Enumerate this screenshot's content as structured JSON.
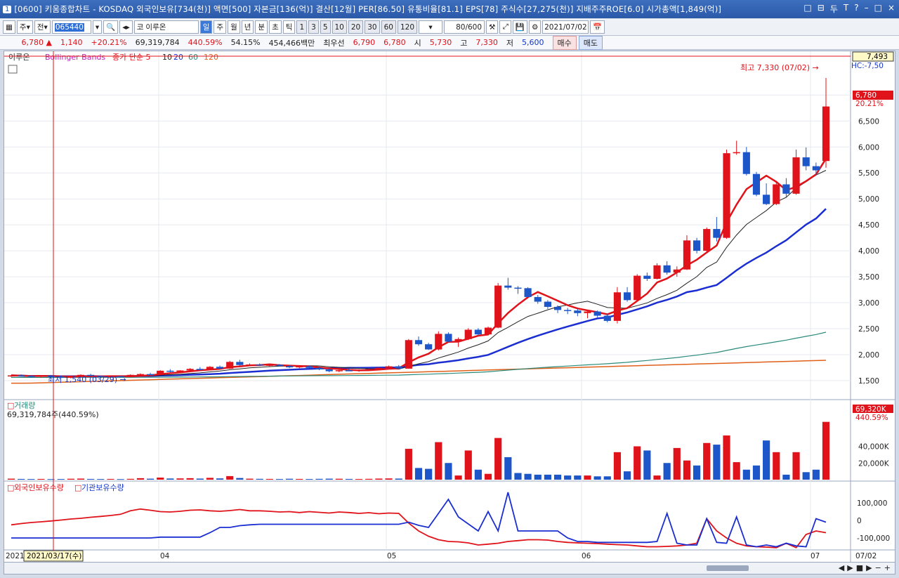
{
  "title": {
    "window_num": "1",
    "text": "[0600] 키움종합차트 - KOSDAQ 외국인보유[734(천)] 액면[500] 자본금[136(억)] 결산[12월] PER[86.50] 유통비율[81.1] EPS[78] 주식수[27,275(천)] 지배주주ROE[6.0] 시가총액[1,849(억)]",
    "controls": [
      "□",
      "⊟",
      "두",
      "T",
      "?",
      "–",
      "□",
      "×"
    ]
  },
  "toolbar": {
    "type_select": "주",
    "market_select": "전",
    "stock_code": "065440",
    "stock_name": "이루온",
    "periods": [
      "일",
      "주",
      "월",
      "년",
      "분",
      "초",
      "틱"
    ],
    "period_selected": "일",
    "intervals": [
      "1",
      "3",
      "5",
      "10",
      "20",
      "30",
      "60",
      "120"
    ],
    "count": "80/600",
    "date": "2021/07/02"
  },
  "pricebar": {
    "price": "6,780 ▲",
    "change": "1,140",
    "change_pct": "+20.21%",
    "volume": "69,319,784",
    "volume_pct": "440.59%",
    "turnover_pct": "54.15%",
    "amount": "454,466백만",
    "priority_label": "최우선",
    "ask": "6,790",
    "bid": "6,780",
    "open_label": "시",
    "open": "5,730",
    "high_label": "고",
    "high": "7,330",
    "low_label": "저",
    "low": "5,600",
    "buy_label": "매수",
    "sell_label": "매도"
  },
  "chart_labels": {
    "stock": "이루온",
    "bollinger": "Bollinger Bands",
    "ma_title": "종가 단순 5",
    "ma_periods": [
      "10",
      "20",
      "60",
      "120"
    ],
    "high_note": "최고 7,330 (07/02) →",
    "low_note": "최저 1,540 (03/29) →",
    "hc_label": "HC:-7,50",
    "price_tag": "6,780",
    "price_pct_tag": "20.21%",
    "top_price_tag": "7,493",
    "volume_title": "거래량",
    "volume_value": "69,319,784주(440.59%)",
    "volume_tag": "69,320K",
    "volume_pct_tag": "440.59%",
    "holdings_foreign": "외국인보유수량",
    "holdings_inst": "기관보유수량",
    "date_box": "2021/03/17(수)",
    "month_start": "2021/",
    "month_labels": [
      "04",
      "05",
      "06",
      "07"
    ],
    "end_date": "07/02"
  },
  "chart_data": {
    "type": "candlestick",
    "price_ticks": [
      7000,
      6500,
      6000,
      5500,
      5000,
      4500,
      4000,
      3500,
      3000,
      2500,
      2000,
      1500
    ],
    "price_range": [
      1350,
      7600
    ],
    "volume_ticks": [
      "40,000K",
      "20,000K"
    ],
    "volume_range": [
      0,
      80000
    ],
    "holdings_ticks": [
      "100,000",
      "0",
      "-100,000"
    ],
    "holdings_range": [
      -160000,
      160000
    ],
    "colors": {
      "up": "#e0121a",
      "down": "#1c56c8",
      "ma5": "#e0121a",
      "ma10": "#222222",
      "ma20": "#1a2ed1",
      "ma60": "#2a8a7a",
      "ma120": "#e0601a"
    },
    "candles": [
      [
        1580,
        1610,
        1570,
        1600,
        1200
      ],
      [
        1600,
        1620,
        1580,
        1590,
        900
      ],
      [
        1590,
        1600,
        1560,
        1575,
        800
      ],
      [
        1575,
        1600,
        1560,
        1595,
        900
      ],
      [
        1595,
        1610,
        1570,
        1580,
        700
      ],
      [
        1580,
        1600,
        1550,
        1560,
        800
      ],
      [
        1560,
        1580,
        1540,
        1575,
        1100
      ],
      [
        1575,
        1620,
        1570,
        1610,
        1300
      ],
      [
        1610,
        1630,
        1580,
        1590,
        900
      ],
      [
        1590,
        1600,
        1560,
        1570,
        800
      ],
      [
        1570,
        1590,
        1550,
        1585,
        900
      ],
      [
        1585,
        1600,
        1560,
        1570,
        700
      ],
      [
        1570,
        1620,
        1565,
        1610,
        1000
      ],
      [
        1610,
        1640,
        1600,
        1625,
        1800
      ],
      [
        1625,
        1650,
        1610,
        1615,
        1200
      ],
      [
        1615,
        1700,
        1610,
        1690,
        2500
      ],
      [
        1690,
        1720,
        1660,
        1670,
        1400
      ],
      [
        1670,
        1700,
        1650,
        1695,
        1500
      ],
      [
        1695,
        1740,
        1690,
        1725,
        1800
      ],
      [
        1725,
        1760,
        1700,
        1710,
        1300
      ],
      [
        1710,
        1780,
        1700,
        1765,
        2200
      ],
      [
        1765,
        1790,
        1720,
        1730,
        1500
      ],
      [
        1730,
        1880,
        1725,
        1860,
        4300
      ],
      [
        1860,
        1900,
        1790,
        1800,
        2000
      ],
      [
        1800,
        1830,
        1780,
        1810,
        1200
      ],
      [
        1810,
        1830,
        1780,
        1790,
        1000
      ],
      [
        1790,
        1820,
        1760,
        1805,
        900
      ],
      [
        1805,
        1820,
        1770,
        1780,
        800
      ],
      [
        1780,
        1800,
        1740,
        1755,
        1100
      ],
      [
        1755,
        1790,
        1740,
        1775,
        900
      ],
      [
        1775,
        1790,
        1740,
        1745,
        800
      ],
      [
        1745,
        1760,
        1700,
        1715,
        1000
      ],
      [
        1715,
        1730,
        1660,
        1680,
        1200
      ],
      [
        1680,
        1720,
        1660,
        1700,
        1100
      ],
      [
        1700,
        1730,
        1680,
        1690,
        900
      ],
      [
        1690,
        1720,
        1670,
        1710,
        800
      ],
      [
        1710,
        1740,
        1690,
        1720,
        1000
      ],
      [
        1720,
        1760,
        1700,
        1745,
        1300
      ],
      [
        1745,
        1790,
        1730,
        1775,
        1500
      ],
      [
        1775,
        1800,
        1720,
        1730,
        1300
      ],
      [
        1730,
        2300,
        1730,
        2280,
        37000
      ],
      [
        2280,
        2350,
        2170,
        2200,
        14000
      ],
      [
        2200,
        2230,
        2090,
        2100,
        13000
      ],
      [
        2100,
        2450,
        2080,
        2400,
        45000
      ],
      [
        2400,
        2430,
        2240,
        2250,
        20000
      ],
      [
        2250,
        2330,
        2150,
        2300,
        5000
      ],
      [
        2300,
        2510,
        2280,
        2480,
        35000
      ],
      [
        2480,
        2510,
        2370,
        2390,
        12000
      ],
      [
        2390,
        2540,
        2380,
        2520,
        7000
      ],
      [
        2520,
        3380,
        2510,
        3330,
        50000
      ],
      [
        3330,
        3480,
        3250,
        3290,
        27000
      ],
      [
        3290,
        3320,
        3170,
        3280,
        8000
      ],
      [
        3280,
        3300,
        3080,
        3110,
        7000
      ],
      [
        3110,
        3150,
        2980,
        3020,
        6000
      ],
      [
        3020,
        3050,
        2880,
        2920,
        6000
      ],
      [
        2920,
        2950,
        2800,
        2860,
        6000
      ],
      [
        2860,
        2900,
        2780,
        2850,
        5000
      ],
      [
        2850,
        2880,
        2740,
        2800,
        5000
      ],
      [
        2800,
        2860,
        2700,
        2830,
        5000
      ],
      [
        2830,
        2850,
        2720,
        2750,
        4000
      ],
      [
        2750,
        2780,
        2620,
        2650,
        4000
      ],
      [
        2650,
        3300,
        2600,
        3200,
        33000
      ],
      [
        3200,
        3300,
        3020,
        3050,
        10000
      ],
      [
        3050,
        3550,
        3040,
        3520,
        40000
      ],
      [
        3520,
        3580,
        3420,
        3460,
        35000
      ],
      [
        3460,
        3760,
        3450,
        3720,
        5000
      ],
      [
        3720,
        3800,
        3540,
        3580,
        20000
      ],
      [
        3580,
        3700,
        3500,
        3640,
        38000
      ],
      [
        3640,
        4300,
        3630,
        4200,
        23000
      ],
      [
        4200,
        4250,
        3950,
        4000,
        17000
      ],
      [
        4000,
        4450,
        3980,
        4420,
        44000
      ],
      [
        4420,
        4650,
        4180,
        4250,
        42000
      ],
      [
        4250,
        5950,
        4230,
        5880,
        53000
      ],
      [
        5880,
        6120,
        5850,
        5900,
        21000
      ],
      [
        5900,
        6000,
        5450,
        5480,
        12000
      ],
      [
        5480,
        5520,
        5050,
        5080,
        17000
      ],
      [
        5080,
        5300,
        4880,
        4900,
        47000
      ],
      [
        4900,
        5350,
        4880,
        5280,
        33000
      ],
      [
        5280,
        5400,
        5020,
        5100,
        6000
      ],
      [
        5100,
        5950,
        5080,
        5800,
        33000
      ],
      [
        5800,
        5990,
        5550,
        5630,
        9000
      ],
      [
        5630,
        5700,
        5450,
        5550,
        12000
      ],
      [
        5730,
        7330,
        5600,
        6780,
        69320
      ]
    ],
    "foreign": [
      -25000,
      -18000,
      -12000,
      -8000,
      -3000,
      2000,
      8000,
      12000,
      18000,
      23000,
      28000,
      35000,
      55000,
      65000,
      58000,
      50000,
      48000,
      52000,
      58000,
      60000,
      55000,
      52000,
      56000,
      62000,
      55000,
      55000,
      52000,
      48000,
      50000,
      45000,
      50000,
      46000,
      42000,
      48000,
      45000,
      40000,
      44000,
      38000,
      42000,
      40000,
      -15000,
      -60000,
      -90000,
      -110000,
      -120000,
      -122000,
      -128000,
      -140000,
      -135000,
      -130000,
      -120000,
      -115000,
      -110000,
      -110000,
      -112000,
      -120000,
      -125000,
      -128000,
      -130000,
      -132000,
      -135000,
      -138000,
      -140000,
      -145000,
      -150000,
      -150000,
      -148000,
      -145000,
      -140000,
      -130000,
      10000,
      -60000,
      -100000,
      -130000,
      -145000,
      -150000,
      -152000,
      -155000,
      -130000,
      -155000,
      -80000,
      -60000,
      -70000
    ],
    "institution": [
      -100000,
      -100000,
      -100000,
      -100000,
      -100000,
      -100000,
      -100000,
      -100000,
      -100000,
      -100000,
      -100000,
      -100000,
      -100000,
      -100000,
      -100000,
      -95000,
      -95000,
      -95000,
      -95000,
      -95000,
      -70000,
      -40000,
      -40000,
      -30000,
      -25000,
      -22000,
      -22000,
      -22000,
      -22000,
      -22000,
      -22000,
      -22000,
      -22000,
      -22000,
      -22000,
      -22000,
      -22000,
      -22000,
      -22000,
      -22000,
      -10000,
      -28000,
      -40000,
      40000,
      120000,
      20000,
      -20000,
      -60000,
      50000,
      -60000,
      160000,
      -60000,
      -60000,
      -60000,
      -60000,
      -60000,
      -100000,
      -120000,
      -120000,
      -125000,
      -125000,
      -125000,
      -125000,
      -125000,
      -125000,
      -120000,
      40000,
      -130000,
      -140000,
      -140000,
      10000,
      -125000,
      -130000,
      20000,
      -140000,
      -150000,
      -140000,
      -150000,
      -130000,
      -145000,
      -150000,
      10000,
      -10000
    ]
  }
}
